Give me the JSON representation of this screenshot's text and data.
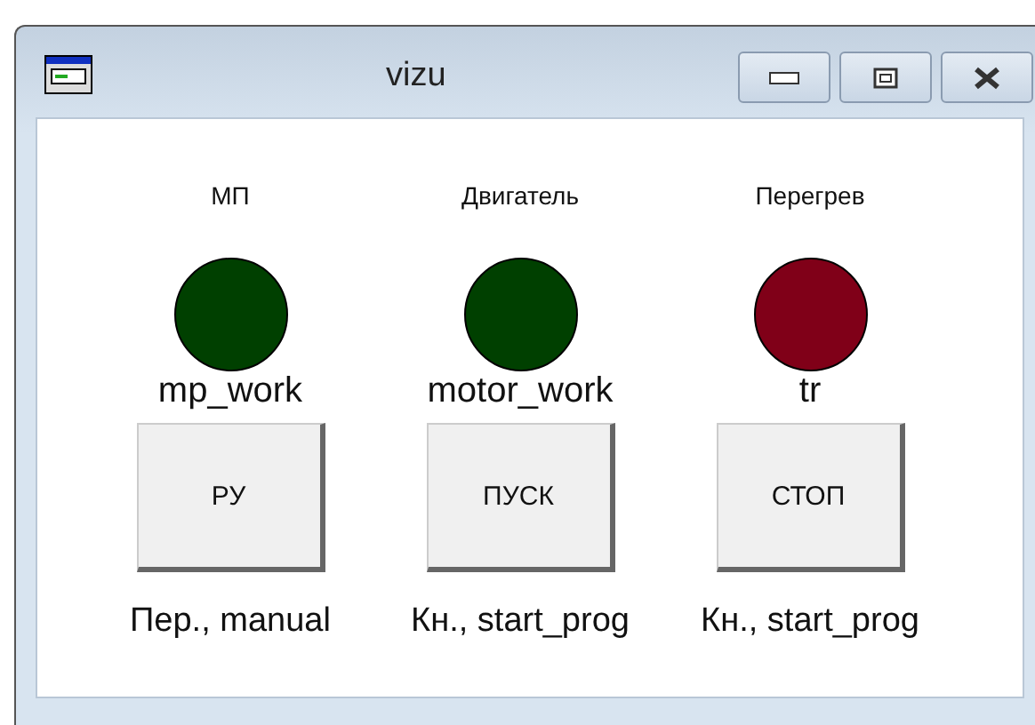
{
  "window": {
    "title": "vizu"
  },
  "indicators": [
    {
      "label": "МП",
      "name": "mp_work",
      "color": "#004000"
    },
    {
      "label": "Двигатель",
      "name": "motor_work",
      "color": "#004000"
    },
    {
      "label": "Перегрев",
      "name": "tr",
      "color": "#800018"
    }
  ],
  "buttons": [
    {
      "label": "РУ",
      "caption": "Пер., manual"
    },
    {
      "label": "ПУСК",
      "caption": "Кн., start_prog"
    },
    {
      "label": "СТОП",
      "caption": "Кн., start_prog"
    }
  ]
}
